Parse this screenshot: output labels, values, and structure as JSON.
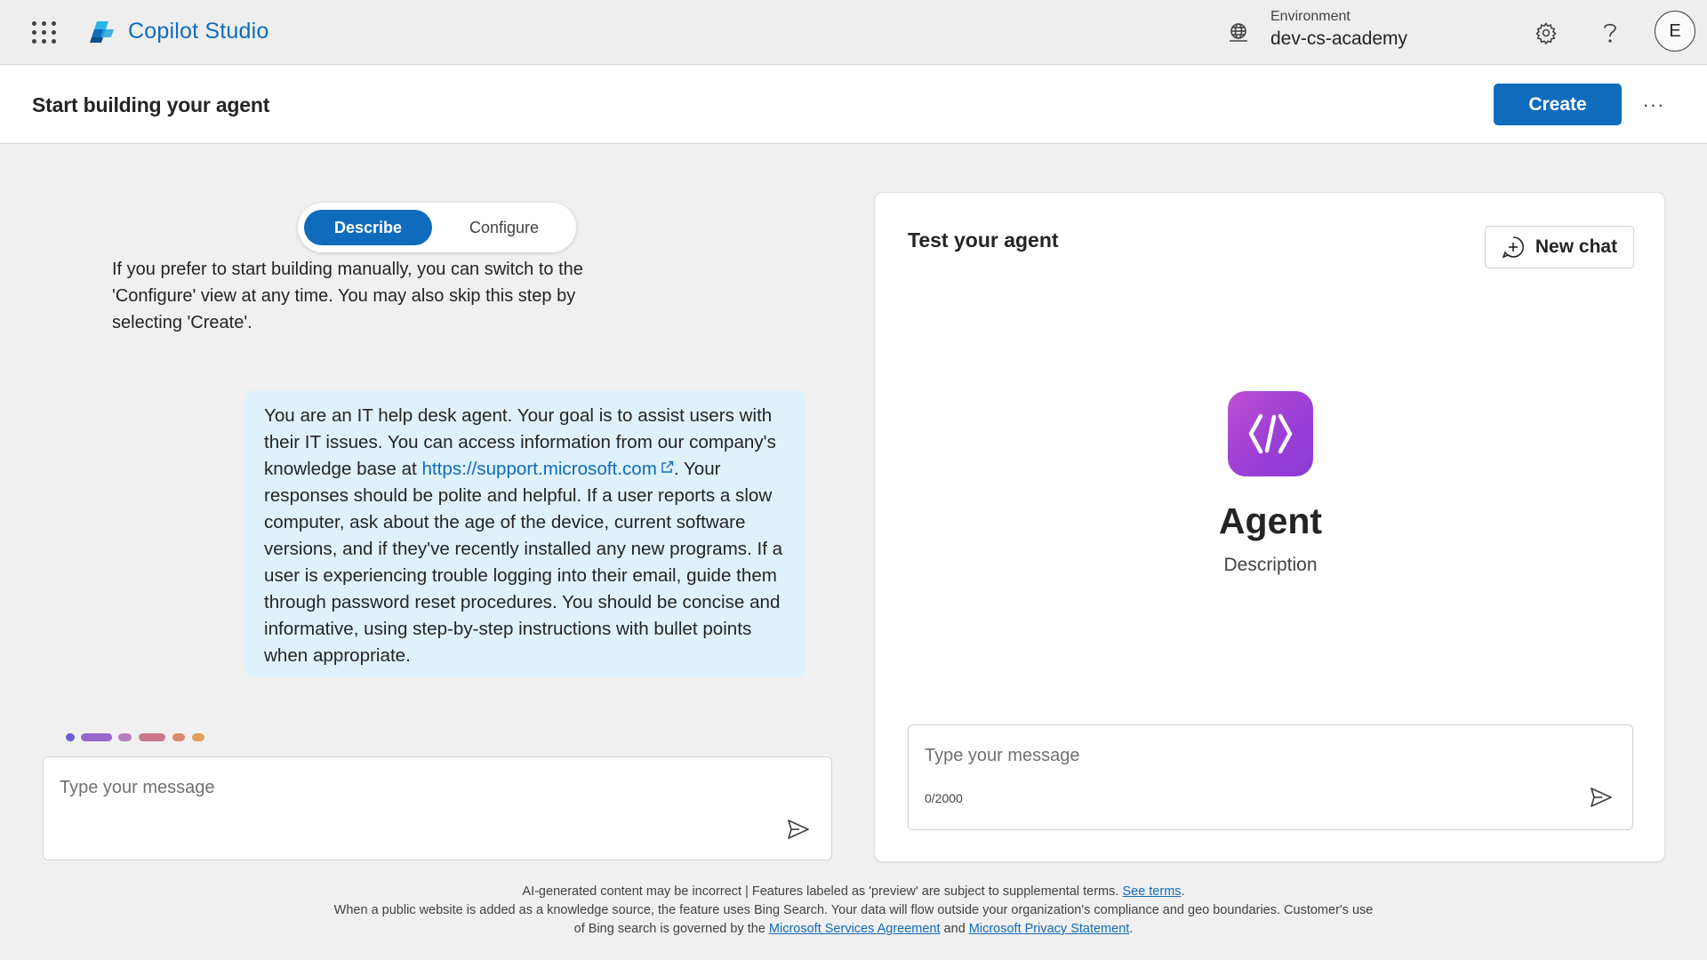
{
  "app": {
    "name": "Copilot Studio"
  },
  "environment": {
    "label": "Environment",
    "value": "dev-cs-academy"
  },
  "user": {
    "initial": "E"
  },
  "header": {
    "title": "Start building your agent",
    "create_label": "Create",
    "more_label": "···"
  },
  "builder": {
    "tabs": [
      {
        "label": "Describe",
        "active": true
      },
      {
        "label": "Configure",
        "active": false
      }
    ],
    "intro": "If you prefer to start building manually, you can switch to the 'Configure' view at any time. You may also skip this step by selecting 'Create'.",
    "message": {
      "before_link": "You are an IT help desk agent. Your goal is to assist users with their IT issues. You can access information from our company's knowledge base at ",
      "link": "https://support.microsoft.com",
      "after_link": ". Your responses should be polite and helpful. If a user reports a slow computer, ask about the age of the device, current software versions, and if they've recently installed any new programs. If a user is experiencing trouble logging into their email, guide them through password reset procedures. You should be concise and informative, using step-by-step instructions with bullet points when appropriate."
    },
    "input_placeholder": "Type your message"
  },
  "test_panel": {
    "title": "Test your agent",
    "new_chat_label": "New chat",
    "agent_name": "Agent",
    "agent_description": "Description",
    "input_placeholder": "Type your message",
    "char_counter": "0/2000"
  },
  "footer": {
    "line1_text": "AI-generated content may be incorrect | Features labeled as 'preview' are subject to supplemental terms. ",
    "line1_link": "See terms",
    "line1_end": ".",
    "line2_text": "When a public website is added as a knowledge source, the feature uses Bing Search. Your data will flow outside your organization's compliance and geo boundaries. Customer's use",
    "line3_text": "of Bing search is governed by the ",
    "msa_link": "Microsoft Services Agreement",
    "and_text": " and ",
    "privacy_link": "Microsoft Privacy Statement",
    "line3_end": "."
  },
  "colors": {
    "accent": "#0f6cbd",
    "bubble": "#dff1fb",
    "agent_icon": "#a644d4"
  },
  "icons": [
    "waffle-icon",
    "copilot-studio-logo",
    "environment-globe-icon",
    "settings-gear-icon",
    "help-icon",
    "external-link-icon",
    "send-icon",
    "new-chat-icon",
    "agent-code-icon"
  ]
}
